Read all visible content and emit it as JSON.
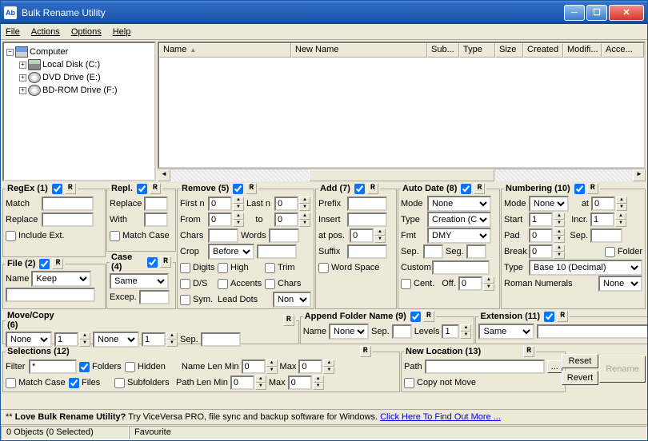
{
  "title": "Bulk Rename Utility",
  "menu": {
    "file": "File",
    "actions": "Actions",
    "options": "Options",
    "help": "Help"
  },
  "tree": {
    "root": "Computer",
    "items": [
      {
        "label": "Local Disk (C:)"
      },
      {
        "label": "DVD Drive (E:)"
      },
      {
        "label": "BD-ROM Drive (F:)"
      }
    ]
  },
  "columns": {
    "name": "Name",
    "newname": "New Name",
    "sub": "Sub...",
    "type": "Type",
    "size": "Size",
    "created": "Created",
    "modified": "Modifi...",
    "accessed": "Acce..."
  },
  "reset_btn": "R",
  "regex": {
    "legend": "RegEx (1)",
    "match": "Match",
    "replace": "Replace",
    "include": "Include Ext."
  },
  "repl": {
    "legend": "Repl.",
    "replace": "Replace",
    "with": "With",
    "matchcase": "Match Case"
  },
  "file": {
    "legend": "File (2)",
    "name": "Name",
    "keep": "Keep"
  },
  "case": {
    "legend": "Case (4)",
    "same": "Same",
    "excep": "Excep."
  },
  "remove": {
    "legend": "Remove (5)",
    "firstn": "First n",
    "lastn": "Last n",
    "from": "From",
    "to": "to",
    "chars": "Chars",
    "words": "Words",
    "crop": "Crop",
    "before": "Before",
    "digits": "Digits",
    "high": "High",
    "trim": "Trim",
    "ds": "D/S",
    "accents": "Accents",
    "charscb": "Chars",
    "sym": "Sym.",
    "leaddots": "Lead Dots",
    "non": "Non",
    "v0": "0"
  },
  "add": {
    "legend": "Add (7)",
    "prefix": "Prefix",
    "insert": "Insert",
    "atpos": "at pos.",
    "suffix": "Suffix",
    "wordspace": "Word Space",
    "v0": "0"
  },
  "autodate": {
    "legend": "Auto Date (8)",
    "mode": "Mode",
    "none": "None",
    "type": "Type",
    "creation": "Creation (Cur",
    "fmt": "Fmt",
    "dmy": "DMY",
    "sep": "Sep.",
    "seg": "Seg.",
    "custom": "Custom",
    "cent": "Cent.",
    "off": "Off.",
    "v0": "0"
  },
  "numbering": {
    "legend": "Numbering (10)",
    "mode": "Mode",
    "none": "None",
    "at": "at",
    "start": "Start",
    "incr": "Incr.",
    "pad": "Pad",
    "sep": "Sep.",
    "break": "Break",
    "folder": "Folder",
    "type": "Type",
    "base10": "Base 10 (Decimal)",
    "roman": "Roman Numerals",
    "v0": "0",
    "v1": "1"
  },
  "movecopy": {
    "legend": "Move/Copy (6)",
    "none": "None",
    "sep": "Sep.",
    "v1": "1"
  },
  "appendfolder": {
    "legend": "Append Folder Name (9)",
    "name": "Name",
    "none": "None",
    "sep": "Sep.",
    "levels": "Levels",
    "v1": "1"
  },
  "extension": {
    "legend": "Extension (11)",
    "same": "Same"
  },
  "selections": {
    "legend": "Selections (12)",
    "filter": "Filter",
    "filterval": "*",
    "folders": "Folders",
    "hidden": "Hidden",
    "namelenmin": "Name Len Min",
    "max": "Max",
    "matchcase": "Match Case",
    "files": "Files",
    "subfolders": "Subfolders",
    "pathlenmin": "Path Len Min",
    "v0": "0"
  },
  "newlocation": {
    "legend": "New Location (13)",
    "path": "Path",
    "browse": "...",
    "copynotmove": "Copy not Move"
  },
  "buttons": {
    "reset": "Reset",
    "revert": "Revert",
    "rename": "Rename"
  },
  "promo": {
    "prefix": "** ",
    "bold": "Love Bulk Rename Utility?",
    "mid": " Try ViceVersa PRO, file sync and backup software for Windows. ",
    "link": "Click Here To Find Out More ..."
  },
  "status": {
    "objects": "0 Objects (0 Selected)",
    "fav": "Favourite"
  }
}
